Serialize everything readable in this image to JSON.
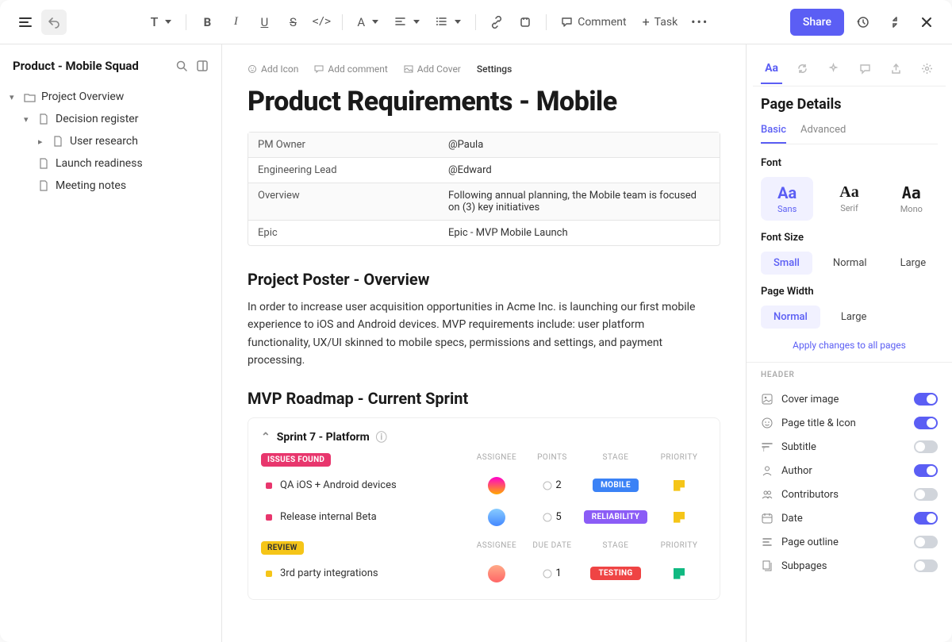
{
  "topbar": {
    "comment": "Comment",
    "task": "Task",
    "share": "Share",
    "text_label": "T"
  },
  "sidebar": {
    "title": "Product - Mobile Squad",
    "tree": [
      {
        "label": "Project Overview",
        "icon": "folder",
        "children": [
          {
            "label": "Decision register",
            "icon": "doc",
            "children": [
              {
                "label": "User research",
                "icon": "doc"
              }
            ]
          },
          {
            "label": "Launch readiness",
            "icon": "doc"
          },
          {
            "label": "Meeting notes",
            "icon": "doc"
          }
        ]
      }
    ]
  },
  "meta": {
    "add_icon": "Add Icon",
    "add_comment": "Add comment",
    "add_cover": "Add Cover",
    "settings": "Settings"
  },
  "page": {
    "title": "Product Requirements - Mobile",
    "table": [
      {
        "k": "PM Owner",
        "v": "@Paula"
      },
      {
        "k": "Engineering Lead",
        "v": "@Edward"
      },
      {
        "k": "Overview",
        "v": "Following annual planning, the Mobile team is focused on (3) key initiatives"
      },
      {
        "k": "Epic",
        "v": "Epic - MVP Mobile Launch"
      }
    ],
    "poster_heading": "Project Poster - Overview",
    "poster_body": "In order to increase user acquisition opportunities in Acme Inc. is launching our first mobile experience to iOS and Android devices. MVP requirements include: user platform functionality, UX/UI skinned to mobile specs, permissions and settings, and payment processing.",
    "roadmap_heading": "MVP Roadmap - Current Sprint",
    "sprint": {
      "name": "Sprint  7 - Platform",
      "groups": [
        {
          "pill": "ISSUES FOUND",
          "pillClass": "pill-issues",
          "columns": [
            "ASSIGNEE",
            "POINTS",
            "STAGE",
            "PRIORITY"
          ],
          "tasks": [
            {
              "dot": "#e8366d",
              "name": "QA iOS + Android devices",
              "avatar": "a1",
              "points": "2",
              "stage": "MOBILE",
              "stageClass": "stage-mobile",
              "flag": "flag-y"
            },
            {
              "dot": "#e8366d",
              "name": "Release internal Beta",
              "avatar": "a2",
              "points": "5",
              "stage": "RELIABILITY",
              "stageClass": "stage-reliability",
              "flag": "flag-y"
            }
          ]
        },
        {
          "pill": "REVIEW",
          "pillClass": "pill-review",
          "columns": [
            "ASSIGNEE",
            "DUE DATE",
            "STAGE",
            "PRIORITY"
          ],
          "tasks": [
            {
              "dot": "#f5c518",
              "name": "3rd party integrations",
              "avatar": "a3",
              "points": "1",
              "stage": "TESTING",
              "stageClass": "stage-testing",
              "flag": "flag-g"
            }
          ]
        }
      ]
    }
  },
  "panel": {
    "title": "Page Details",
    "subtabs": {
      "basic": "Basic",
      "advanced": "Advanced"
    },
    "font_label": "Font",
    "fonts": [
      {
        "big": "Aa",
        "small": "Sans",
        "active": true
      },
      {
        "big": "Aa",
        "small": "Serif"
      },
      {
        "big": "Aa",
        "small": "Mono"
      }
    ],
    "size_label": "Font Size",
    "sizes": [
      {
        "label": "Small",
        "active": true
      },
      {
        "label": "Normal"
      },
      {
        "label": "Large"
      }
    ],
    "width_label": "Page Width",
    "widths": [
      {
        "label": "Normal",
        "active": true
      },
      {
        "label": "Large"
      }
    ],
    "apply_link": "Apply changes to all pages",
    "header_cat": "HEADER",
    "toggles": [
      {
        "icon": "image",
        "label": "Cover image",
        "on": true
      },
      {
        "icon": "smile",
        "label": "Page title & Icon",
        "on": true
      },
      {
        "icon": "subtitle",
        "label": "Subtitle",
        "on": false
      },
      {
        "icon": "user",
        "label": "Author",
        "on": true
      },
      {
        "icon": "users",
        "label": "Contributors",
        "on": false
      },
      {
        "icon": "calendar",
        "label": "Date",
        "on": true
      },
      {
        "icon": "outline",
        "label": "Page outline",
        "on": false
      },
      {
        "icon": "pages",
        "label": "Subpages",
        "on": false
      }
    ]
  }
}
